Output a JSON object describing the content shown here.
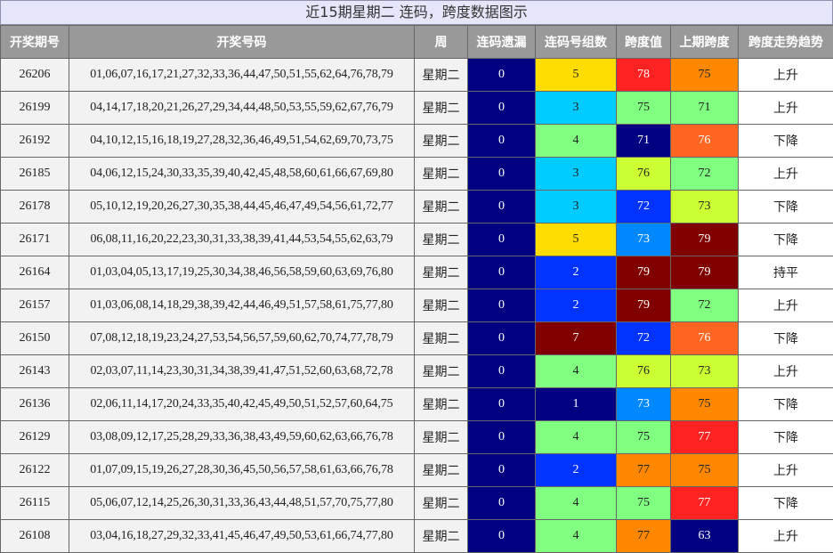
{
  "title": "近15期星期二 连码，跨度数据图示",
  "headers": [
    "开奖期号",
    "开奖号码",
    "周",
    "连码遗漏",
    "连码号组数",
    "跨度值",
    "上期跨度",
    "跨度走势趋势"
  ],
  "colors": {
    "header_bg": "#999999",
    "navy": "#000080",
    "blue": "#0033ff",
    "azure": "#0088ff",
    "cyan": "#00ccff",
    "green": "#80ff80",
    "lime": "#ccff33",
    "yellow": "#ffdd00",
    "orange": "#ff8800",
    "redorange": "#ff6622",
    "red": "#ff2222",
    "maroon": "#800000"
  },
  "rows": [
    {
      "issue": "26206",
      "numbers": "01,06,07,16,17,21,27,32,33,36,44,47,50,51,55,62,64,76,78,79",
      "weekday": "星期二",
      "miss": "0",
      "groups": "5",
      "groups_color": "yellow",
      "span": "78",
      "span_color": "red",
      "prev": "75",
      "prev_color": "orange",
      "trend": "上升"
    },
    {
      "issue": "26199",
      "numbers": "04,14,17,18,20,21,26,27,29,34,44,48,50,53,55,59,62,67,76,79",
      "weekday": "星期二",
      "miss": "0",
      "groups": "3",
      "groups_color": "cyan",
      "span": "75",
      "span_color": "green",
      "prev": "71",
      "prev_color": "green",
      "trend": "上升"
    },
    {
      "issue": "26192",
      "numbers": "04,10,12,15,16,18,19,27,28,32,36,46,49,51,54,62,69,70,73,75",
      "weekday": "星期二",
      "miss": "0",
      "groups": "4",
      "groups_color": "green",
      "span": "71",
      "span_color": "navy",
      "prev": "76",
      "prev_color": "redorange",
      "trend": "下降"
    },
    {
      "issue": "26185",
      "numbers": "04,06,12,15,24,30,33,35,39,40,42,45,48,58,60,61,66,67,69,80",
      "weekday": "星期二",
      "miss": "0",
      "groups": "3",
      "groups_color": "cyan",
      "span": "76",
      "span_color": "lime",
      "prev": "72",
      "prev_color": "green",
      "trend": "上升"
    },
    {
      "issue": "26178",
      "numbers": "05,10,12,19,20,26,27,30,35,38,44,45,46,47,49,54,56,61,72,77",
      "weekday": "星期二",
      "miss": "0",
      "groups": "3",
      "groups_color": "cyan",
      "span": "72",
      "span_color": "blue",
      "prev": "73",
      "prev_color": "lime",
      "trend": "下降"
    },
    {
      "issue": "26171",
      "numbers": "06,08,11,16,20,22,23,30,31,33,38,39,41,44,53,54,55,62,63,79",
      "weekday": "星期二",
      "miss": "0",
      "groups": "5",
      "groups_color": "yellow",
      "span": "73",
      "span_color": "azure",
      "prev": "79",
      "prev_color": "maroon",
      "trend": "下降"
    },
    {
      "issue": "26164",
      "numbers": "01,03,04,05,13,17,19,25,30,34,38,46,56,58,59,60,63,69,76,80",
      "weekday": "星期二",
      "miss": "0",
      "groups": "2",
      "groups_color": "blue",
      "span": "79",
      "span_color": "maroon",
      "prev": "79",
      "prev_color": "maroon",
      "trend": "持平"
    },
    {
      "issue": "26157",
      "numbers": "01,03,06,08,14,18,29,38,39,42,44,46,49,51,57,58,61,75,77,80",
      "weekday": "星期二",
      "miss": "0",
      "groups": "2",
      "groups_color": "blue",
      "span": "79",
      "span_color": "maroon",
      "prev": "72",
      "prev_color": "green",
      "trend": "上升"
    },
    {
      "issue": "26150",
      "numbers": "07,08,12,18,19,23,24,27,53,54,56,57,59,60,62,70,74,77,78,79",
      "weekday": "星期二",
      "miss": "0",
      "groups": "7",
      "groups_color": "maroon",
      "span": "72",
      "span_color": "blue",
      "prev": "76",
      "prev_color": "redorange",
      "trend": "下降"
    },
    {
      "issue": "26143",
      "numbers": "02,03,07,11,14,23,30,31,34,38,39,41,47,51,52,60,63,68,72,78",
      "weekday": "星期二",
      "miss": "0",
      "groups": "4",
      "groups_color": "green",
      "span": "76",
      "span_color": "lime",
      "prev": "73",
      "prev_color": "lime",
      "trend": "上升"
    },
    {
      "issue": "26136",
      "numbers": "02,06,11,14,17,20,24,33,35,40,42,45,49,50,51,52,57,60,64,75",
      "weekday": "星期二",
      "miss": "0",
      "groups": "1",
      "groups_color": "navy",
      "span": "73",
      "span_color": "azure",
      "prev": "75",
      "prev_color": "orange",
      "trend": "下降"
    },
    {
      "issue": "26129",
      "numbers": "03,08,09,12,17,25,28,29,33,36,38,43,49,59,60,62,63,66,76,78",
      "weekday": "星期二",
      "miss": "0",
      "groups": "4",
      "groups_color": "green",
      "span": "75",
      "span_color": "green",
      "prev": "77",
      "prev_color": "red",
      "trend": "下降"
    },
    {
      "issue": "26122",
      "numbers": "01,07,09,15,19,26,27,28,30,36,45,50,56,57,58,61,63,66,76,78",
      "weekday": "星期二",
      "miss": "0",
      "groups": "2",
      "groups_color": "blue",
      "span": "77",
      "span_color": "orange",
      "prev": "75",
      "prev_color": "orange",
      "trend": "上升"
    },
    {
      "issue": "26115",
      "numbers": "05,06,07,12,14,25,26,30,31,33,36,43,44,48,51,57,70,75,77,80",
      "weekday": "星期二",
      "miss": "0",
      "groups": "4",
      "groups_color": "green",
      "span": "75",
      "span_color": "green",
      "prev": "77",
      "prev_color": "red",
      "trend": "下降"
    },
    {
      "issue": "26108",
      "numbers": "03,04,16,18,27,29,32,33,41,45,46,47,49,50,53,61,66,74,77,80",
      "weekday": "星期二",
      "miss": "0",
      "groups": "4",
      "groups_color": "green",
      "span": "77",
      "span_color": "orange",
      "prev": "63",
      "prev_color": "navy",
      "trend": "上升"
    }
  ]
}
